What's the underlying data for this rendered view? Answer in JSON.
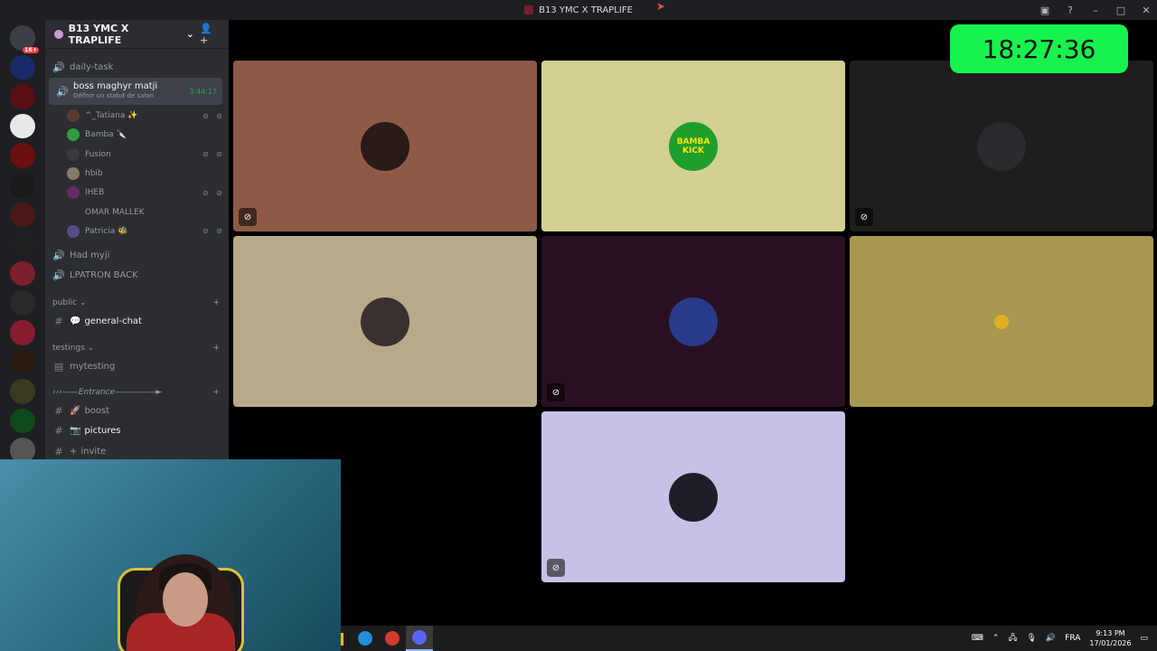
{
  "window": {
    "title": "B13 YMC X TRAPLIFE"
  },
  "rail": {
    "servers": [
      {
        "name": "server-1",
        "color": "#3b3e45",
        "badge": "1K+"
      },
      {
        "name": "server-2",
        "color": "#1a2a6a",
        "badge": ""
      },
      {
        "name": "server-3",
        "color": "#5a0f18",
        "badge": ""
      },
      {
        "name": "server-4",
        "color": "#e8e8e8",
        "badge": ""
      },
      {
        "name": "server-5",
        "color": "#6a1010",
        "badge": ""
      },
      {
        "name": "server-6",
        "color": "#1a1a1a",
        "badge": ""
      },
      {
        "name": "server-7",
        "color": "#4a1a1a",
        "badge": ""
      },
      {
        "name": "server-8",
        "color": "#202020",
        "badge": ""
      },
      {
        "name": "server-9",
        "color": "#7a1f2b",
        "badge": ""
      },
      {
        "name": "server-10",
        "color": "#2a2a2a",
        "badge": ""
      },
      {
        "name": "server-11",
        "color": "#8a1a30",
        "badge": ""
      },
      {
        "name": "server-12",
        "color": "#2a1a10",
        "badge": ""
      },
      {
        "name": "server-13",
        "color": "#3a3a20",
        "badge": ""
      },
      {
        "name": "server-14",
        "color": "#0f4a1a",
        "badge": ""
      },
      {
        "name": "server-15",
        "color": "#555555",
        "badge": ""
      }
    ]
  },
  "sidebar": {
    "guild_name": "B13 YMC X TRAPLIFE",
    "channels": {
      "daily_task": "daily-task",
      "voice_active": "boss maghyr matji",
      "voice_active_status": "Définir un statut de salon",
      "voice_timer": "3:44:17",
      "had_myji": "Had myji",
      "lpatron": "LPATRON BACK",
      "general_chat": "general-chat",
      "mytesting": "mytesting",
      "boost": "boost",
      "pictures": "pictures",
      "invite": "invite"
    },
    "categories": {
      "public": "public",
      "testings": "testings",
      "entrance": "›››——Entrance—————►"
    },
    "voice_users": [
      {
        "name": "^_Tatiana ✨",
        "color": "#5a3a30",
        "muted": "⊘ ⊘"
      },
      {
        "name": "Bamba 🔪",
        "color": "#2e9e3a",
        "muted": ""
      },
      {
        "name": "Fusion",
        "color": "#3a3a3a",
        "muted": "⊘ ⊘"
      },
      {
        "name": "hbib",
        "color": "#8a7a6a",
        "muted": ""
      },
      {
        "name": "IHEB",
        "color": "#6a2a6a",
        "muted": "⊘ ⊘"
      },
      {
        "name": "OMAR MALLEK",
        "color": "#2b2d31",
        "muted": ""
      },
      {
        "name": "Patricia 🐝",
        "color": "#5a4a8a",
        "muted": "⊘ ⊘"
      }
    ]
  },
  "clock": {
    "time": "18:27:36"
  },
  "tiles": [
    {
      "name": "tile-tatiana",
      "bg": "#8e5a47",
      "avatar": "#2a1a18",
      "label": "",
      "deaf": true
    },
    {
      "name": "tile-bamba",
      "bg": "#d2d092",
      "avatar": "#1f9e2c",
      "label": "BAMBA KICK",
      "deaf": false
    },
    {
      "name": "tile-fusion",
      "bg": "#1e1e1f",
      "avatar": "#2a2a30",
      "label": "",
      "deaf": true
    },
    {
      "name": "tile-hbib",
      "bg": "#b8a98a",
      "avatar": "#3a3030",
      "label": "",
      "deaf": false
    },
    {
      "name": "tile-iheb",
      "bg": "#2a0f22",
      "avatar": "#2a3a8a",
      "label": "",
      "deaf": true
    },
    {
      "name": "tile-omar",
      "bg": "#a8984f",
      "avatar": "#a8984f",
      "label": "",
      "deaf": false
    },
    {
      "name": "tile-patricia",
      "bg": "#c9c0e6",
      "avatar": "#1e1e28",
      "label": "",
      "deaf": true
    }
  ],
  "taskbar": {
    "apps": [
      {
        "name": "edge-app",
        "color": "#1e8fd8"
      },
      {
        "name": "chrome-app",
        "color": "#d23b2f"
      },
      {
        "name": "discord-app",
        "color": "#5865f2"
      }
    ],
    "language": "FRA",
    "time": "9:13 PM",
    "date": "17/01/2026"
  }
}
